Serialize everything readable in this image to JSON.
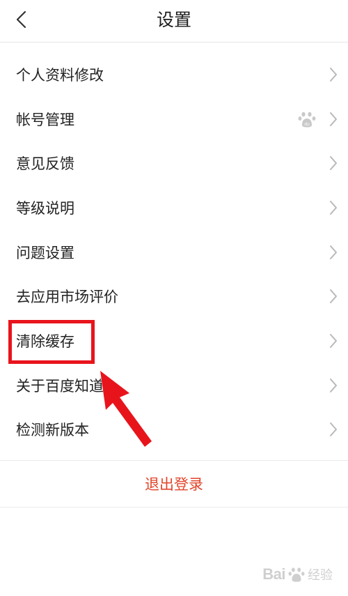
{
  "header": {
    "title": "设置"
  },
  "settings_items": [
    {
      "label": "个人资料修改"
    },
    {
      "label": "帐号管理"
    },
    {
      "label": "意见反馈"
    },
    {
      "label": "等级说明"
    },
    {
      "label": "问题设置"
    },
    {
      "label": "去应用市场评价"
    },
    {
      "label": "清除缓存"
    },
    {
      "label": "关于百度知道"
    },
    {
      "label": "检测新版本"
    }
  ],
  "logout": {
    "label": "退出登录"
  },
  "colors": {
    "accent_logout": "#e0452b",
    "annotation_red": "#e8141c",
    "chevron": "#b8b8b8"
  },
  "icons": {
    "back": "chevron-left-icon",
    "row_chevron": "chevron-right-icon",
    "account_badge": "baidu-paw-icon"
  },
  "watermark": {
    "text": "Bai",
    "text2": "经验"
  }
}
